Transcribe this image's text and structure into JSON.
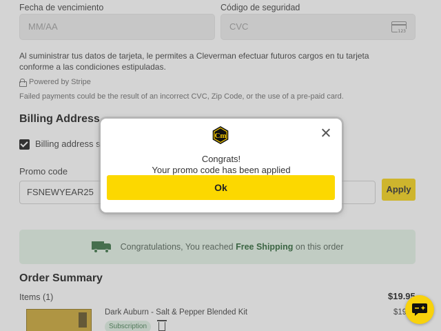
{
  "payment": {
    "expiry_label": "Fecha de vencimiento",
    "expiry_placeholder": "MM/AA",
    "cvc_label": "Código de seguridad",
    "cvc_placeholder": "CVC",
    "card_icon_text": "123",
    "terms_text": "Al suministrar tus datos de tarjeta, le permites a Cleverman efectuar futuros cargos en tu tarjeta conforme a las condiciones estipuladas.",
    "stripe_text": "Powered by Stripe",
    "failed_text": "Failed payments could be the result of an incorrect CVC, Zip Code, or the use of a pre-paid card."
  },
  "billing": {
    "title": "Billing Address",
    "checkbox_label": "Billing address sa",
    "checked": true
  },
  "promo": {
    "label": "Promo code",
    "value": "FSNEWYEAR25",
    "apply_label": "Apply"
  },
  "shipping": {
    "prefix": "Congratulations, You reached ",
    "highlight": "Free Shipping",
    "suffix": " on this order"
  },
  "order": {
    "title": "Order Summary",
    "items_label": "Items (1)",
    "total": "$19.95",
    "product_name": "Dark Auburn - Salt & Pepper Blended Kit",
    "badge": "Subscription",
    "price": "$19.9"
  },
  "modal": {
    "title": "Congrats!",
    "message": "Your promo code has been applied",
    "ok_label": "Ok"
  },
  "colors": {
    "accent": "#fcd800",
    "shipping_bg": "#e3f3e6",
    "shipping_text": "#1e5c2a"
  }
}
